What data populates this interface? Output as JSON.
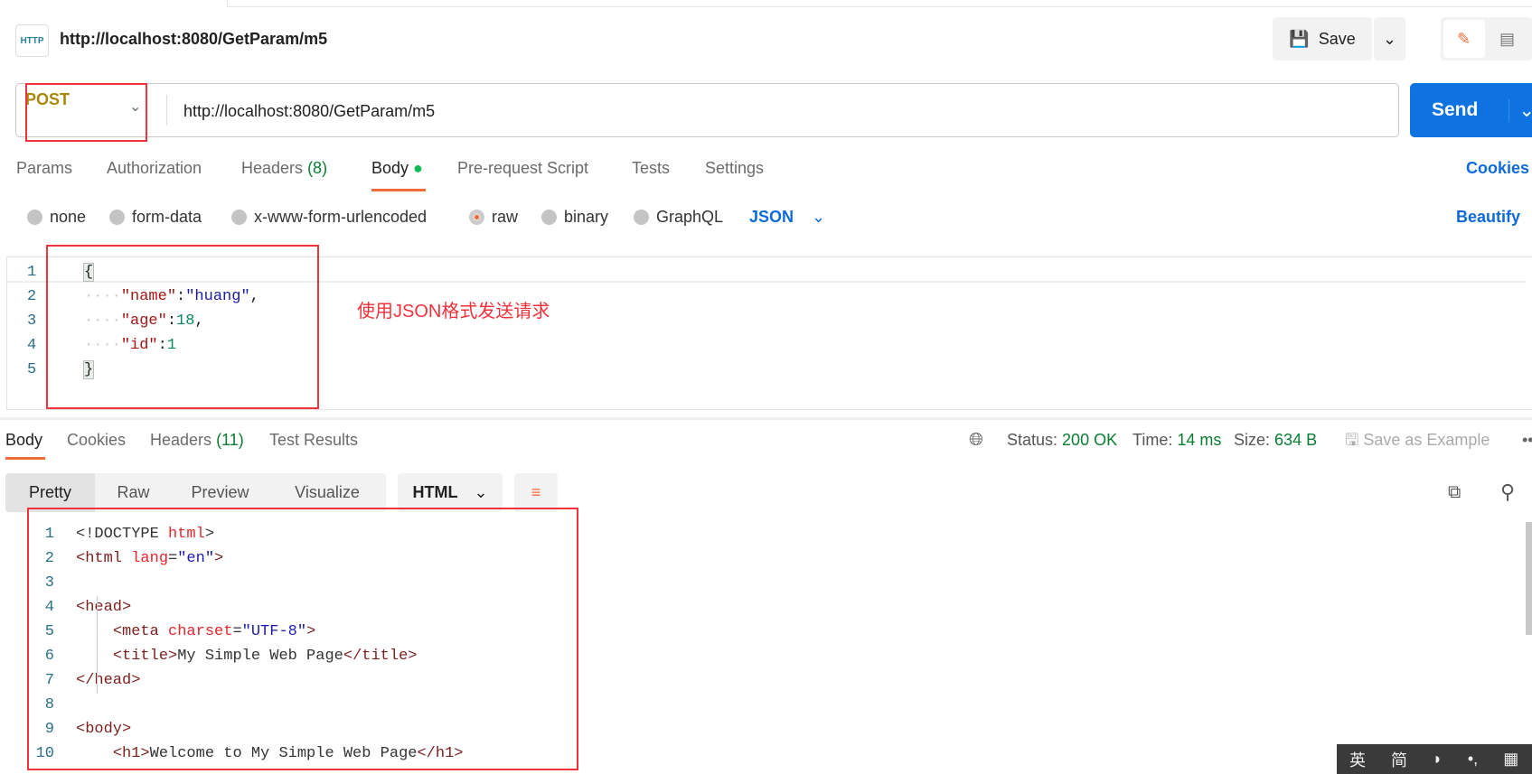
{
  "header": {
    "title": "http://localhost:8080/GetParam/m5",
    "icon": "http-icon",
    "save_label": "Save"
  },
  "request": {
    "method": "POST",
    "url": "http://localhost:8080/GetParam/m5",
    "send_label": "Send"
  },
  "tabs": {
    "params": "Params",
    "authorization": "Authorization",
    "headers": "Headers",
    "headers_count": "(8)",
    "body": "Body",
    "prerequest": "Pre-request Script",
    "tests": "Tests",
    "settings": "Settings",
    "cookies": "Cookies"
  },
  "body_types": {
    "none": "none",
    "form_data": "form-data",
    "urlencoded": "x-www-form-urlencoded",
    "raw": "raw",
    "binary": "binary",
    "graphql": "GraphQL",
    "format": "JSON",
    "beautify": "Beautify",
    "selected": "raw"
  },
  "request_body": {
    "lines": [
      "1",
      "2",
      "3",
      "4",
      "5"
    ],
    "brace_open": "{",
    "brace_close": "}",
    "k1": "\"name\"",
    "v1": "\"huang\"",
    "k2": "\"age\"",
    "v2": "18",
    "k3": "\"id\"",
    "v3": "1"
  },
  "annotation": "使用JSON格式发送请求",
  "response": {
    "tabs": {
      "body": "Body",
      "cookies": "Cookies",
      "headers": "Headers",
      "headers_count": "(11)",
      "tests": "Test Results"
    },
    "status_label": "Status:",
    "status": "200 OK",
    "time_label": "Time:",
    "time": "14 ms",
    "size_label": "Size:",
    "size": "634 B",
    "save_example": "Save as Example",
    "views": {
      "pretty": "Pretty",
      "raw": "Raw",
      "preview": "Preview",
      "visualize": "Visualize"
    },
    "format": "HTML",
    "code": [
      {
        "n": "1",
        "parts": [
          [
            "punc",
            "<!DOCTYPE "
          ],
          [
            "attr",
            "html"
          ],
          [
            "punc",
            ">"
          ]
        ]
      },
      {
        "n": "2",
        "parts": [
          [
            "tag",
            "<html "
          ],
          [
            "attr",
            "lang"
          ],
          [
            "punc",
            "="
          ],
          [
            "str",
            "\"en\""
          ],
          [
            "tag",
            ">"
          ]
        ]
      },
      {
        "n": "3",
        "parts": []
      },
      {
        "n": "4",
        "parts": [
          [
            "tag",
            "<head>"
          ]
        ]
      },
      {
        "n": "5",
        "parts": [
          [
            "punc",
            "    "
          ],
          [
            "tag",
            "<meta "
          ],
          [
            "attr",
            "charset"
          ],
          [
            "punc",
            "="
          ],
          [
            "str",
            "\"UTF-8\""
          ],
          [
            "tag",
            ">"
          ]
        ]
      },
      {
        "n": "6",
        "parts": [
          [
            "punc",
            "    "
          ],
          [
            "tag",
            "<title>"
          ],
          [
            "punc",
            "My Simple Web Page"
          ],
          [
            "tag",
            "</title>"
          ]
        ]
      },
      {
        "n": "7",
        "parts": [
          [
            "tag",
            "</head>"
          ]
        ]
      },
      {
        "n": "8",
        "parts": []
      },
      {
        "n": "9",
        "parts": [
          [
            "tag",
            "<body>"
          ]
        ]
      },
      {
        "n": "10",
        "parts": [
          [
            "punc",
            "    "
          ],
          [
            "tag",
            "<h1>"
          ],
          [
            "punc",
            "Welcome to My Simple Web Page"
          ],
          [
            "tag",
            "</h1>"
          ]
        ]
      }
    ]
  },
  "ime": {
    "lang": "英",
    "mode": "简"
  },
  "colors": {
    "accent": "#0e72e0",
    "method": "#a8870a",
    "tab_underline": "#f26b3a",
    "status": "#0a7d32",
    "annotation": "#f0323c"
  }
}
